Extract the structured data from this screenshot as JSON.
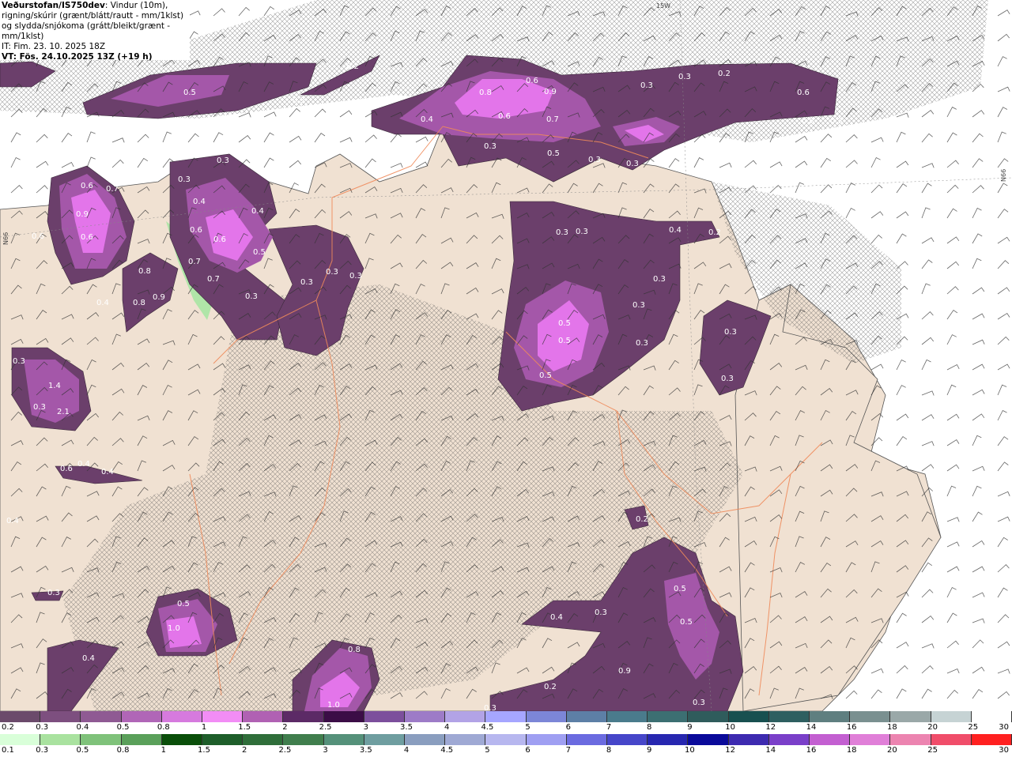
{
  "title": {
    "bold_prefix": "Veðurstofan/IS750dev",
    "description": ": Vindur (10m), rigning/skúrir (grænt/blátt/rautt - mm/1klst) og slydda/snjókoma (grátt/bleikt/grænt - mm/1klst)",
    "initial_time": "IT: Fim. 23. 10. 2025 18Z",
    "valid_time": "VT: Fös. 24.10.2025 13Z (+19 h)"
  },
  "map_labels": {
    "grid_top": "15W",
    "grid_left": "N66",
    "grid_right": "N66"
  },
  "precip_values": [
    "0.5",
    "0.2",
    "0.3",
    "0.4",
    "0.8",
    "0.9",
    "0.6",
    "0.7",
    "0.3",
    "0.5",
    "0.3",
    "0.6",
    "0.3",
    "0.3",
    "0.2",
    "0.6",
    "0.8",
    "0.3",
    "0.2",
    "0.3",
    "0.3",
    "0.3",
    "0.2",
    "0.3",
    "0.6",
    "0.7",
    "0.6",
    "0.9",
    "0.4",
    "0.4",
    "0.6",
    "0.6",
    "0.5",
    "0.7",
    "0.7",
    "0.3",
    "0.3",
    "0.3",
    "0.3",
    "0.4",
    "0.8",
    "0.9",
    "0.8",
    "0.6",
    "0.3",
    "0.4",
    "0.3",
    "0.3",
    "0.5",
    "0.5",
    "0.5",
    "0.3",
    "0.3",
    "0.3",
    "0.3",
    "1.4",
    "2.1",
    "0.3",
    "0.6",
    "0.4",
    "0.4",
    "0.5",
    "1.0",
    "0.4",
    "0.3",
    "0.4",
    "0.3",
    "0.5",
    "0.5",
    "0.4",
    "0.9",
    "0.3",
    "0.2",
    "0.3",
    "0.8",
    "1.0",
    "0.2"
  ],
  "legend_top": {
    "labels": [
      "0.2",
      "0.3",
      "0.4",
      "0.5",
      "0.8",
      "1",
      "1.5",
      "2",
      "2.5",
      "3",
      "3.5",
      "4",
      "4.5",
      "5",
      "6",
      "7",
      "8",
      "9",
      "10",
      "12",
      "14",
      "16",
      "18",
      "20",
      "25",
      "30"
    ],
    "colors": [
      "#6b4a6b",
      "#7d4f7f",
      "#8f5a93",
      "#b066b7",
      "#d67ade",
      "#f28df5",
      "#b061b3",
      "#5c2a66",
      "#3b0d46",
      "#7c4f9c",
      "#9d7bc7",
      "#b2a3e6",
      "#a6a6ff",
      "#7c86d7",
      "#5d7fa6",
      "#4a7b8c",
      "#3c6f72",
      "#2f5c5c",
      "#185050",
      "#2e5f60",
      "#5f7f80",
      "#7a9090",
      "#9aa8a8",
      "#c6d3d4",
      "#ffffff"
    ]
  },
  "legend_bottom": {
    "labels": [
      "0.1",
      "0.3",
      "0.5",
      "0.8",
      "1",
      "1.5",
      "2",
      "2.5",
      "3",
      "3.5",
      "4",
      "4.5",
      "5",
      "6",
      "7",
      "8",
      "9",
      "10",
      "12",
      "14",
      "16",
      "18",
      "20",
      "25",
      "30"
    ],
    "colors": [
      "#d9ffd9",
      "#a9e29f",
      "#7fc27a",
      "#5aa05a",
      "#0a4f0a",
      "#1e5e2a",
      "#2f6e3a",
      "#407e4d",
      "#55917a",
      "#6f9ea0",
      "#8a9ebf",
      "#9fa9d4",
      "#b7b7ef",
      "#9f9ff2",
      "#6b6be0",
      "#4646c9",
      "#2727b0",
      "#0a0a9a",
      "#3d2ab0",
      "#7a3fc9",
      "#c35fd1",
      "#e07fd8",
      "#ec84b0",
      "#f04d6a",
      "#ff2020"
    ]
  },
  "colors": {
    "land": "#f0e1d2",
    "sea": "#ffffff",
    "precip_light": "#6b3f6b",
    "precip_mid": "#a457a9",
    "precip_high": "#e375ea",
    "rain_green": "#a9e6a3",
    "roads": "#ef8a5a"
  }
}
